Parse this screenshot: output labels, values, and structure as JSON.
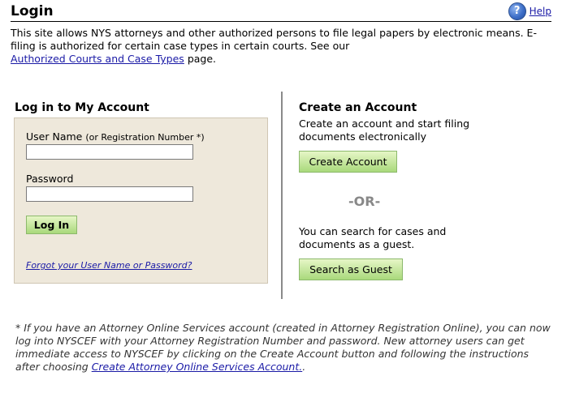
{
  "header": {
    "title": "Login",
    "help_icon": "question-mark-icon",
    "help_label": "Help"
  },
  "intro": {
    "text_1": "This site allows NYS attorneys and other authorized persons to file legal papers by electronic means. E-filing is authorized for certain case types in certain courts. See our",
    "link": "Authorized Courts and Case Types",
    "text_2": "page."
  },
  "login": {
    "title": "Log in to My Account",
    "username_label": "User Name",
    "username_hint": "(or Registration Number *)",
    "username_value": "",
    "password_label": "Password",
    "password_value": "",
    "submit_label": "Log In",
    "forgot_link": "Forgot your User Name or Password?"
  },
  "create": {
    "title": "Create an Account",
    "description": "Create an account and start filing documents electronically",
    "button_label": "Create Account",
    "or_text": "-OR-",
    "guest_description": "You can search for cases and documents as a guest.",
    "guest_button_label": "Search as Guest"
  },
  "footnote": {
    "text": "* If you have an Attorney Online Services account (created in Attorney Registration Online), you can now log into NYSCEF with your Attorney Registration Number and password. New attorney users can get immediate access to NYSCEF by clicking on the Create Account button and following the instructions after choosing",
    "link": "Create Attorney Online Services Account.",
    "suffix": "."
  },
  "colors": {
    "link": "#1a1aa6",
    "login_panel_bg": "#eee8db",
    "button_green": "#a9d97b"
  }
}
